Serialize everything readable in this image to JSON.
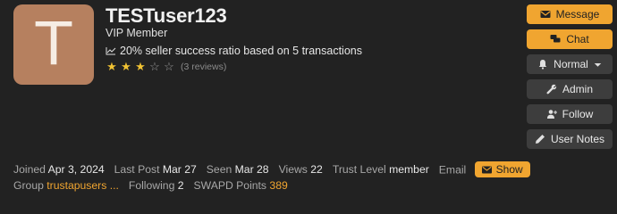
{
  "avatar": {
    "letter": "T",
    "color": "#b6805f"
  },
  "user": {
    "username": "TESTuser123",
    "title": "VIP Member",
    "ratio_text": "20% seller success ratio based on 5 transactions",
    "rating": 3,
    "rating_max": 5,
    "reviews_text": "(3 reviews)"
  },
  "actions": {
    "message": "Message",
    "chat": "Chat",
    "notification": "Normal",
    "admin": "Admin",
    "follow": "Follow",
    "user_notes": "User Notes"
  },
  "stats": {
    "joined_label": "Joined",
    "joined_value": "Apr 3, 2024",
    "last_post_label": "Last Post",
    "last_post_value": "Mar 27",
    "seen_label": "Seen",
    "seen_value": "Mar 28",
    "views_label": "Views",
    "views_value": "22",
    "trust_label": "Trust Level",
    "trust_value": "member",
    "email_label": "Email",
    "email_show": "Show",
    "group_label": "Group",
    "group_value": "trustapusers ...",
    "following_label": "Following",
    "following_value": "2",
    "points_label": "SWAPD Points",
    "points_value": "389"
  },
  "colors": {
    "accent": "#f0a530",
    "background": "#222222",
    "button": "#3d3d3d",
    "star": "#f0c233"
  }
}
